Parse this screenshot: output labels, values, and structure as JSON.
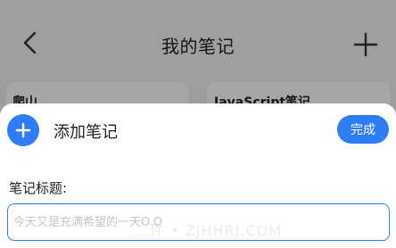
{
  "header": {
    "title": "我的笔记",
    "back_icon": "chevron-left-icon",
    "add_icon": "plus-icon"
  },
  "notes": [
    {
      "title": "爬山"
    },
    {
      "title": "JavaScript笔记"
    }
  ],
  "sheet": {
    "title": "添加笔记",
    "done_label": "完成",
    "field_label": "笔记标题:",
    "input_placeholder": "今天又是充满希望的一天O.O",
    "input_value": "",
    "accent_color": "#2f7df6"
  },
  "watermark": "...件 • ZJHHRJ.COM"
}
